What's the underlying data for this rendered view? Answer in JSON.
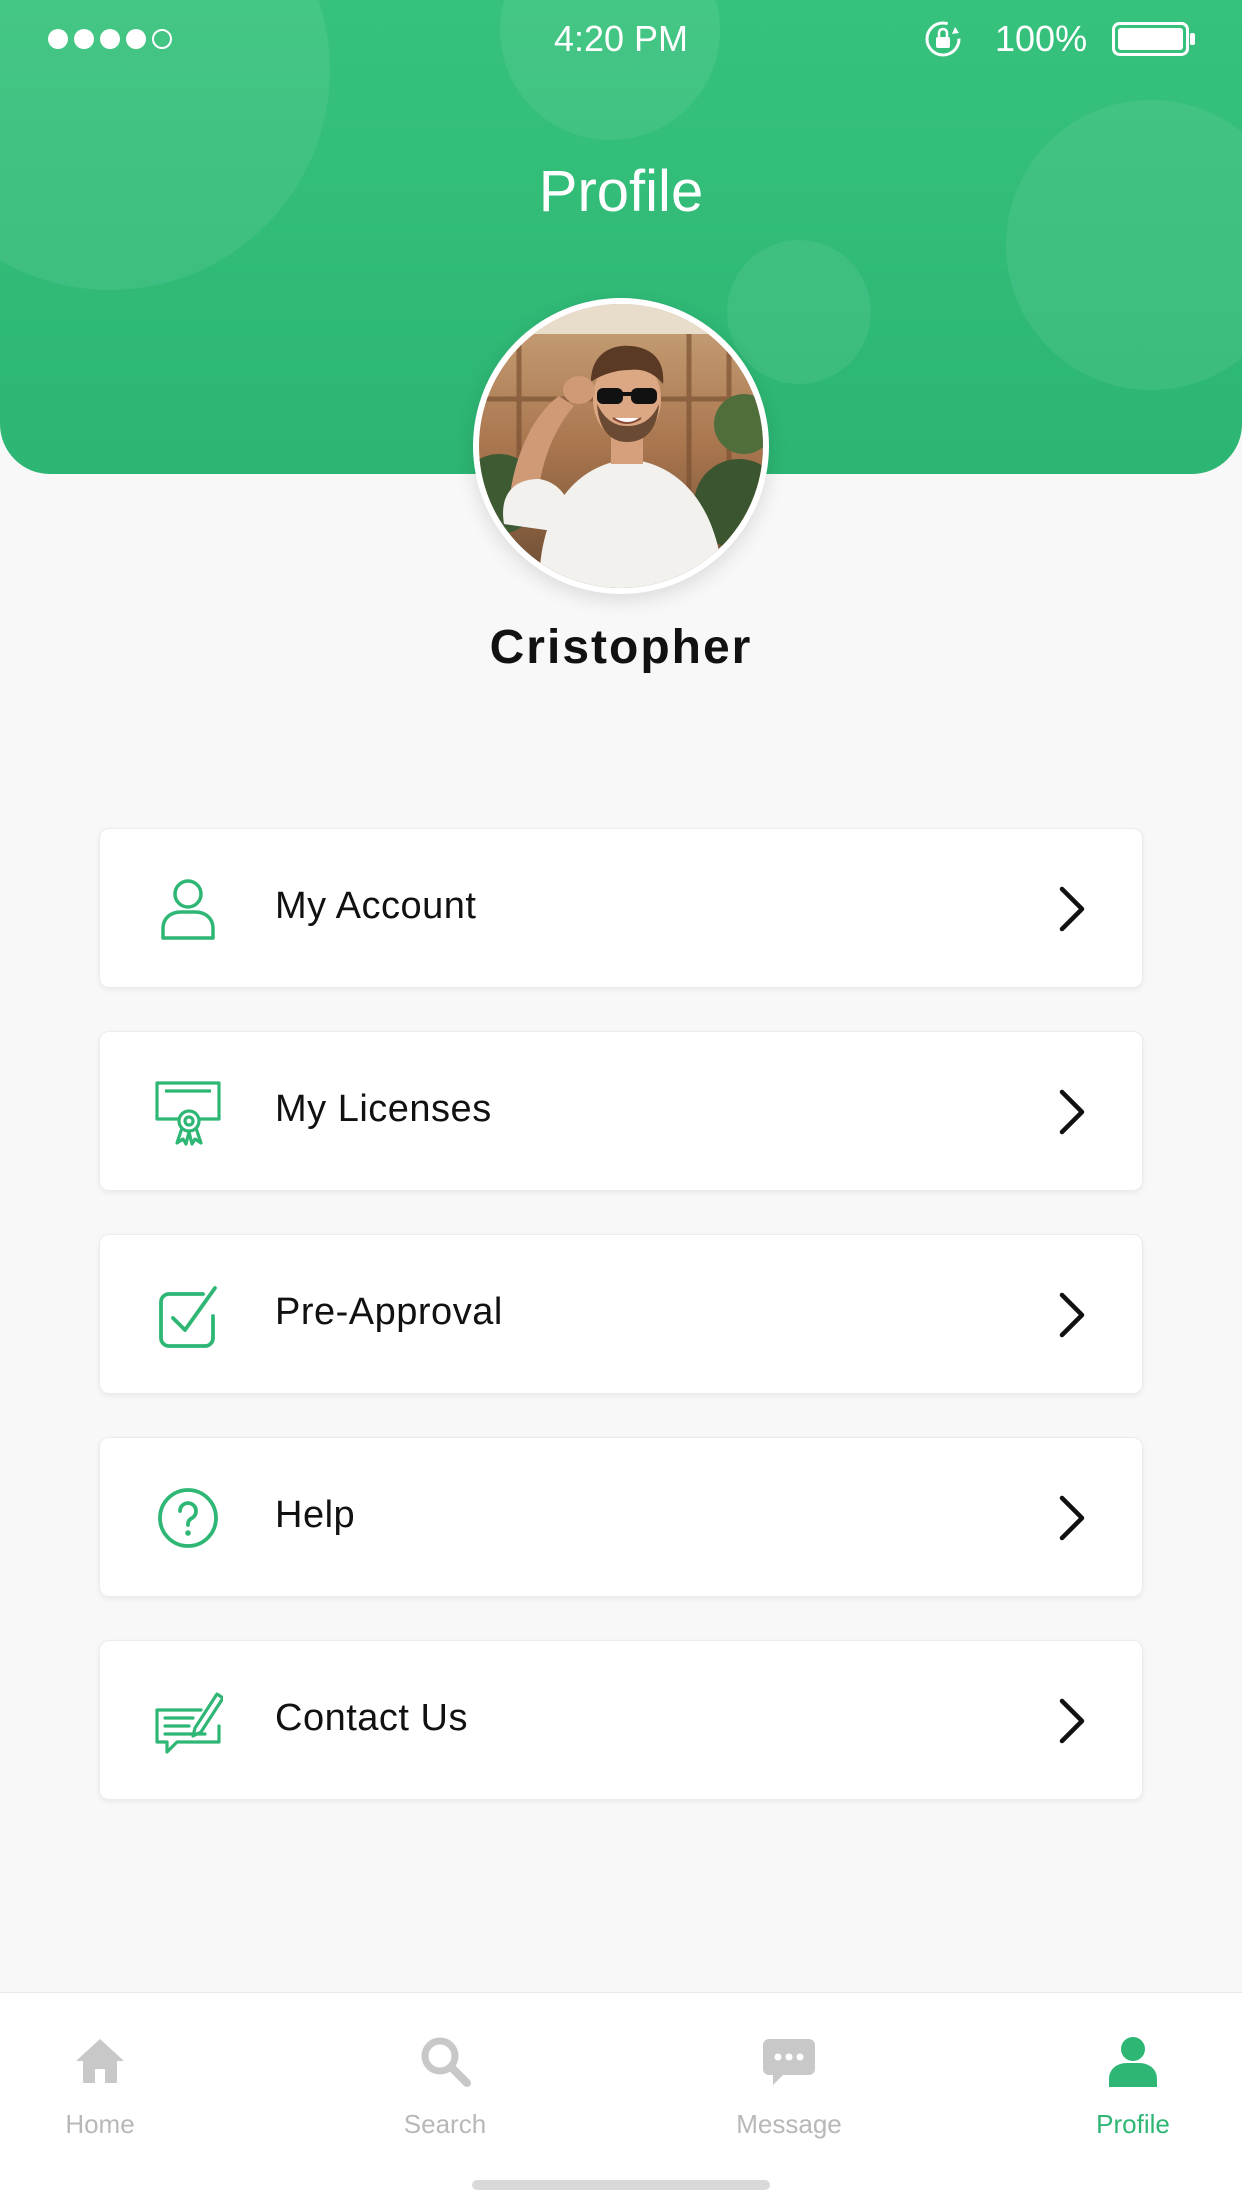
{
  "status_bar": {
    "time": "4:20 PM",
    "battery": "100%",
    "signal_dots_filled": 4,
    "signal_dots_total": 5
  },
  "header": {
    "title": "Profile",
    "background_color": "#34bf79"
  },
  "profile": {
    "name": "Cristopher"
  },
  "menu": {
    "accent_color": "#2eb774",
    "items": [
      {
        "label": "My Account",
        "icon": "user-icon"
      },
      {
        "label": "My Licenses",
        "icon": "certificate-icon"
      },
      {
        "label": "Pre-Approval",
        "icon": "checkbox-icon"
      },
      {
        "label": "Help",
        "icon": "help-icon"
      },
      {
        "label": "Contact Us",
        "icon": "contact-icon"
      }
    ]
  },
  "tabbar": {
    "active": "Profile",
    "active_color": "#2eb774",
    "inactive_color": "#c8c8c8",
    "tabs": [
      {
        "label": "Home",
        "icon": "home-icon"
      },
      {
        "label": "Search",
        "icon": "search-icon"
      },
      {
        "label": "Message",
        "icon": "message-icon"
      },
      {
        "label": "Profile",
        "icon": "profile-icon"
      }
    ]
  }
}
